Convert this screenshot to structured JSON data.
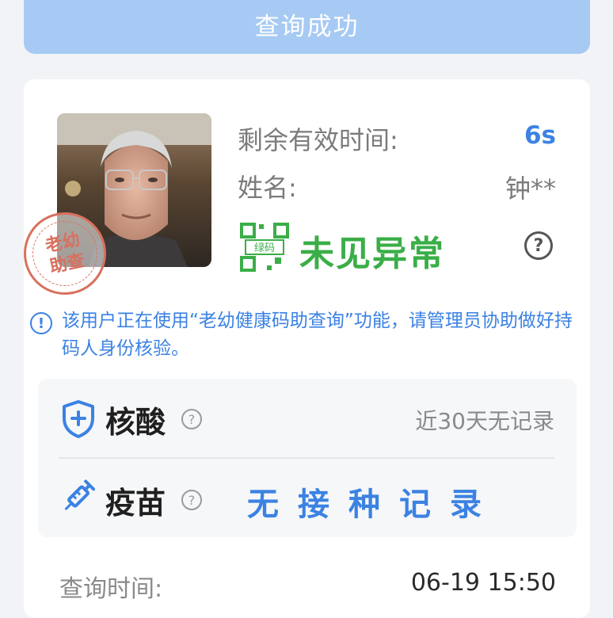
{
  "banner": {
    "label": "查询成功"
  },
  "profile": {
    "stamp_line1": "老幼",
    "stamp_line2": "助查",
    "remaining_label": "剩余有效时间:",
    "remaining_value": "6s",
    "name_label": "姓名:",
    "name_value": "钟**",
    "code_badge": "绿码",
    "status": "未见异常",
    "help_symbol": "?"
  },
  "notice": {
    "icon_symbol": "!",
    "text": "该用户正在使用“老幼健康码助查询”功能，请管理员协助做好持码人身份核验。"
  },
  "records": {
    "nucleic_acid": {
      "label": "核酸",
      "help_symbol": "?",
      "value": "近30天无记录",
      "icon": "shield-plus-icon"
    },
    "vaccine": {
      "label": "疫苗",
      "help_symbol": "?",
      "value": "无接种记录",
      "icon": "syringe-icon"
    }
  },
  "query": {
    "label": "查询时间:",
    "value": "06-19 15:50"
  },
  "colors": {
    "accent": "#3b82e3",
    "green": "#3aae47",
    "banner": "#a6caf3",
    "stamp": "#d9705e"
  }
}
